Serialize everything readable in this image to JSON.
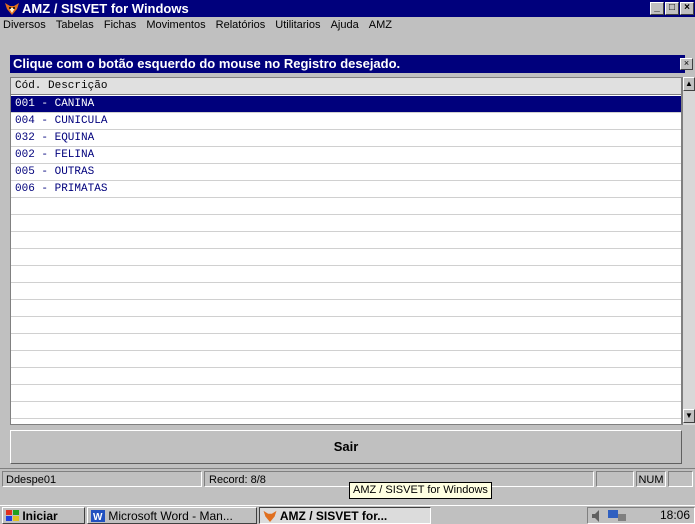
{
  "window": {
    "title": "AMZ / SISVET for Windows"
  },
  "menu": [
    "Diversos",
    "Tabelas",
    "Fichas",
    "Movimentos",
    "Relatórios",
    "Utilitarios",
    "Ajuda",
    "AMZ"
  ],
  "dialog": {
    "instruction": "Clique com o botão esquerdo do mouse no Registro desejado."
  },
  "list": {
    "header": "Cód. Descrição",
    "rows": [
      "001 - CANINA",
      "004 - CUNICULA",
      "032 - EQUINA",
      "002 - FELINA",
      "005 - OUTRAS",
      "006 - PRIMATAS"
    ]
  },
  "buttons": {
    "exit": "Sair"
  },
  "status": {
    "form": "Ddespe01",
    "record": "Record: 8/8",
    "numlock": "NUM"
  },
  "tooltip": "AMZ / SISVET for Windows",
  "taskbar": {
    "start": "Iniciar",
    "items": [
      "Microsoft Word - Man...",
      "AMZ / SISVET for..."
    ],
    "clock": "18:06"
  },
  "colors": {
    "titlebar": "#00007c",
    "selection": "#00007c",
    "face": "#c0c0c0"
  },
  "icons": [
    "fox-app-icon",
    "minimize-icon",
    "maximize-icon",
    "close-icon",
    "scroll-up-icon",
    "scroll-down-icon",
    "windows-logo-icon",
    "word-icon",
    "speaker-icon",
    "network-icon"
  ]
}
